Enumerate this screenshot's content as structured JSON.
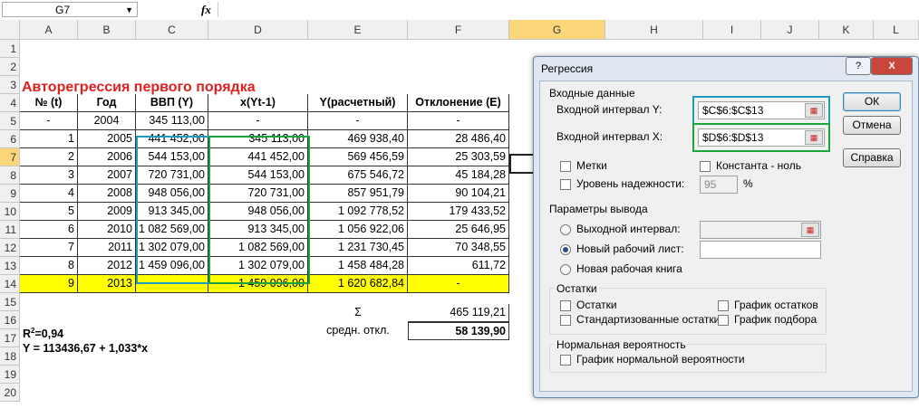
{
  "formula_bar": {
    "name_box": "G7",
    "fx": "fx"
  },
  "columns": [
    "A",
    "B",
    "C",
    "D",
    "E",
    "F",
    "G",
    "H",
    "I",
    "J",
    "K",
    "L"
  ],
  "rows": [
    "1",
    "2",
    "3",
    "4",
    "5",
    "6",
    "7",
    "8",
    "9",
    "10",
    "11",
    "12",
    "13",
    "14",
    "15",
    "16",
    "17",
    "18",
    "19",
    "20"
  ],
  "sheet": {
    "title": "Авторегрессия первого порядка",
    "headers": [
      "№ (t)",
      "Год",
      "ВВП (Y)",
      "x(Yt-1)",
      "Y(расчетный)",
      "Отклонение (Е)"
    ],
    "data": [
      [
        "-",
        "2004",
        "345 113,00",
        "-",
        "-",
        "-"
      ],
      [
        "1",
        "2005",
        "441 452,00",
        "345 113,00",
        "469 938,40",
        "28 486,40"
      ],
      [
        "2",
        "2006",
        "544 153,00",
        "441 452,00",
        "569 456,59",
        "25 303,59"
      ],
      [
        "3",
        "2007",
        "720 731,00",
        "544 153,00",
        "675 546,72",
        "45 184,28"
      ],
      [
        "4",
        "2008",
        "948 056,00",
        "720 731,00",
        "857 951,79",
        "90 104,21"
      ],
      [
        "5",
        "2009",
        "913 345,00",
        "948 056,00",
        "1 092 778,52",
        "179 433,52"
      ],
      [
        "6",
        "2010",
        "1 082 569,00",
        "913 345,00",
        "1 056 922,06",
        "25 646,95"
      ],
      [
        "7",
        "2011",
        "1 302 079,00",
        "1 082 569,00",
        "1 231 730,45",
        "70 348,55"
      ],
      [
        "8",
        "2012",
        "1 459 096,00",
        "1 302 079,00",
        "1 458 484,28",
        "611,72"
      ],
      [
        "9",
        "2013",
        "-",
        "1 459 096,00",
        "1 620 682,84",
        "-"
      ]
    ],
    "sigma_label": "Σ",
    "sigma_value": "465 119,21",
    "r2_label": "R",
    "r2_sup": "2",
    "r2_value": "=0,94",
    "mean_dev_label": "средн. откл.",
    "mean_dev_value": "58 139,90",
    "equation": "Y = 113436,67 + 1,033*x"
  },
  "dialog": {
    "title": "Регрессия",
    "help_btn": "?",
    "close_btn": "X",
    "input_group": "Входные данные",
    "input_y_label": "Входной интервал Y:",
    "input_y_value": "$C$6:$C$13",
    "input_x_label": "Входной интервал X:",
    "input_x_value": "$D$6:$D$13",
    "labels_cb": "Метки",
    "constant_cb": "Константа - ноль",
    "confidence_cb": "Уровень надежности:",
    "confidence_value": "95",
    "percent": "%",
    "output_group": "Параметры вывода",
    "output_range": "Выходной интервал:",
    "new_sheet": "Новый рабочий лист:",
    "new_book": "Новая рабочая книга",
    "residuals_group": "Остатки",
    "residuals_cb": "Остатки",
    "std_residuals_cb": "Стандартизованные остатки",
    "residual_plot_cb": "График остатков",
    "line_fit_cb": "График подбора",
    "normal_group": "Нормальная вероятность",
    "normal_plot_cb": "График нормальной вероятности",
    "ok": "ОК",
    "cancel": "Отмена",
    "help": "Справка"
  },
  "colors": {
    "title_red": "#e0201f",
    "yellow_row": "#ffff00",
    "select_blue": "#1f9bbf",
    "select_green": "#1aa33a"
  }
}
